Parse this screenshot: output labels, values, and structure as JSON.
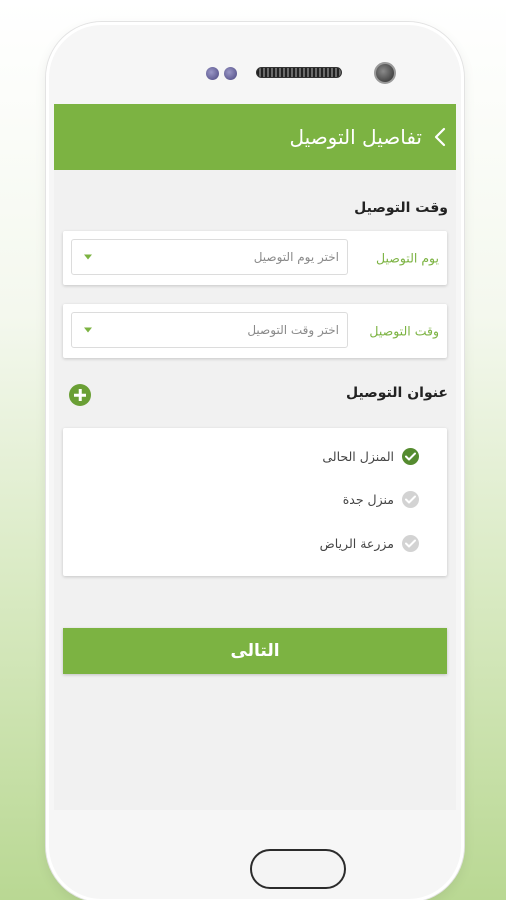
{
  "header": {
    "title": "تفاصيل التوصيل",
    "back_icon": "chevron-right-icon"
  },
  "delivery_time": {
    "title": "وقت التوصيل",
    "day": {
      "label": "يوم التوصيل",
      "placeholder": "اختر يوم التوصيل"
    },
    "time": {
      "label": "وقت التوصيل",
      "placeholder": "اختر وقت التوصيل"
    }
  },
  "address": {
    "title": "عنوان التوصيل",
    "add_icon": "plus-circle-icon",
    "items": [
      {
        "label": "المنزل الحالى",
        "selected": true
      },
      {
        "label": "منزل جدة",
        "selected": false
      },
      {
        "label": "مزرعة الرياض",
        "selected": false
      }
    ]
  },
  "next_button": {
    "label": "التالى"
  },
  "colors": {
    "primary": "#7cb342",
    "selected_check": "#558b2f",
    "unselected_check": "#d3d3d3",
    "add_button": "#6a9f35"
  }
}
